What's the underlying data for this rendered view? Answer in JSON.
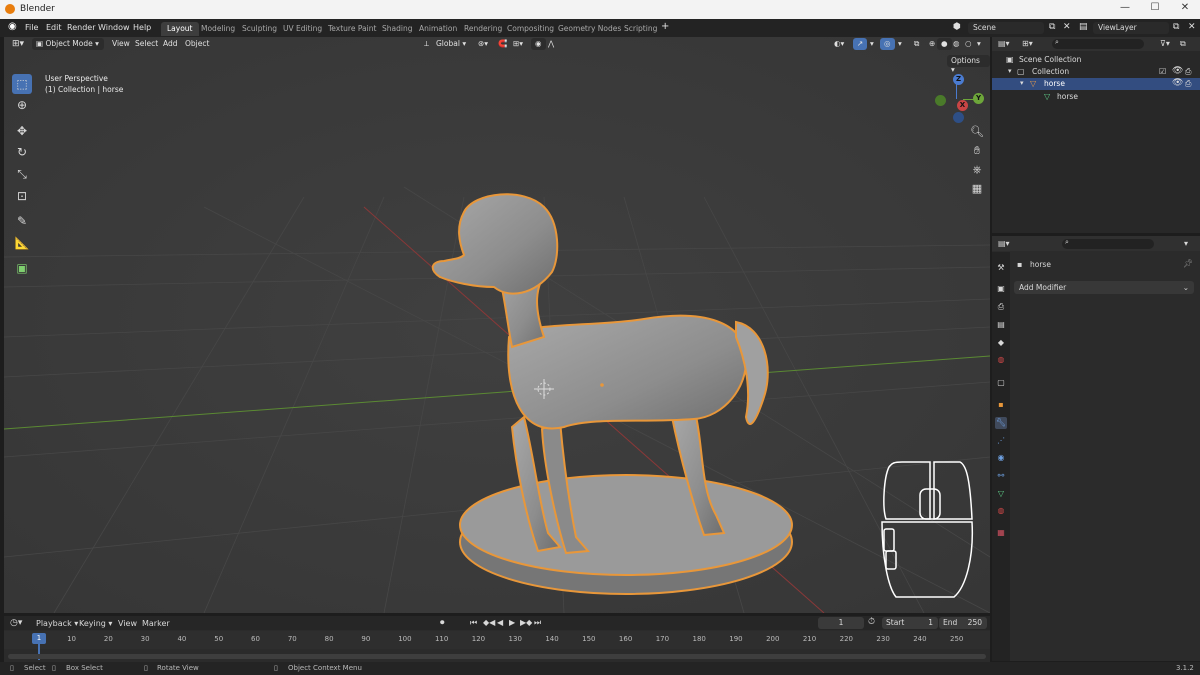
{
  "window": {
    "title": "Blender",
    "controls": [
      "—",
      "☐",
      "✕"
    ]
  },
  "menubar": {
    "menus": [
      "File",
      "Edit",
      "Render",
      "Window",
      "Help"
    ],
    "workspace_tabs": [
      "Layout",
      "Modeling",
      "Sculpting",
      "UV Editing",
      "Texture Paint",
      "Shading",
      "Animation",
      "Rendering",
      "Compositing",
      "Geometry Nodes",
      "Scripting"
    ],
    "active_tab": "Layout",
    "add_tab": "+",
    "scene": "Scene",
    "view_layer": "ViewLayer"
  },
  "viewport": {
    "mode": "Object Mode",
    "menus": [
      "View",
      "Select",
      "Add",
      "Object"
    ],
    "orientation": "Global",
    "options_label": "Options",
    "info_line1": "User Perspective",
    "info_line2": "(1) Collection | horse",
    "gizmo": {
      "x": "X",
      "y": "Y",
      "z": "Z"
    },
    "object_name": "horse"
  },
  "outliner": {
    "items": [
      {
        "label": "Scene Collection",
        "selected": false
      },
      {
        "label": "Collection",
        "selected": false
      },
      {
        "label": "horse",
        "selected": true
      },
      {
        "label": "horse",
        "selected": false
      }
    ]
  },
  "properties": {
    "object": "horse",
    "add_modifier": "Add Modifier"
  },
  "timeline": {
    "menus": [
      "Playback",
      "Keying",
      "View",
      "Marker"
    ],
    "ticks": [
      "1",
      "10",
      "20",
      "30",
      "40",
      "50",
      "60",
      "70",
      "80",
      "90",
      "100",
      "110",
      "120",
      "130",
      "140",
      "150",
      "160",
      "170",
      "180",
      "190",
      "200",
      "210",
      "220",
      "230",
      "240",
      "250"
    ],
    "current_frame": "1",
    "start_label": "Start",
    "start": "1",
    "end_label": "End",
    "end": "250"
  },
  "statusbar": {
    "select": "Select",
    "box_select": "Box Select",
    "rotate_view": "Rotate View",
    "context_menu": "Object Context Menu",
    "version": "3.1.2"
  },
  "colors": {
    "accent": "#4772b3",
    "selection_outline": "#e8973a",
    "x_axis": "#9c3a3a",
    "y_axis": "#6a9a3a"
  }
}
